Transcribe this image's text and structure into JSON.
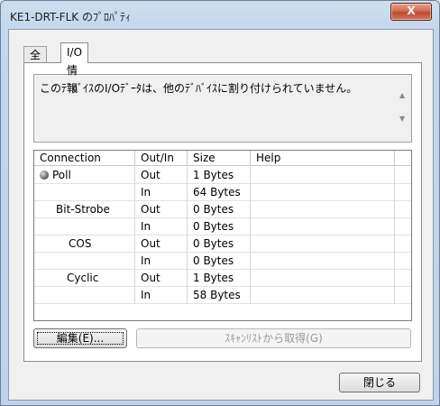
{
  "window": {
    "title": "KE1-DRT-FLK のﾌﾟﾛﾊﾟﾃｨ",
    "close_label": "X"
  },
  "tabs": [
    {
      "label": "全般"
    },
    {
      "label": "I/O情報"
    }
  ],
  "message": "このﾃﾞﾊﾞｲｽのI/Oﾃﾞｰﾀは、他のﾃﾞﾊﾞｲｽに割り付けられていません。",
  "table": {
    "headers": [
      "Connection",
      "Out/In",
      "Size",
      "Help"
    ],
    "rows": [
      {
        "connection": "Poll",
        "dir": "Out",
        "size": "1 Bytes"
      },
      {
        "connection": "",
        "dir": "In",
        "size": "64 Bytes"
      },
      {
        "connection": "Bit-Strobe",
        "dir": "Out",
        "size": "0 Bytes"
      },
      {
        "connection": "",
        "dir": "In",
        "size": "0 Bytes"
      },
      {
        "connection": "COS",
        "dir": "Out",
        "size": "0 Bytes"
      },
      {
        "connection": "",
        "dir": "In",
        "size": "0 Bytes"
      },
      {
        "connection": "Cyclic",
        "dir": "Out",
        "size": "1 Bytes"
      },
      {
        "connection": "",
        "dir": "In",
        "size": "58 Bytes"
      }
    ]
  },
  "buttons": {
    "edit": "編集(E)...",
    "scan": "ｽｷｬﾝﾘｽﾄから取得(G)",
    "close": "閉じる"
  }
}
